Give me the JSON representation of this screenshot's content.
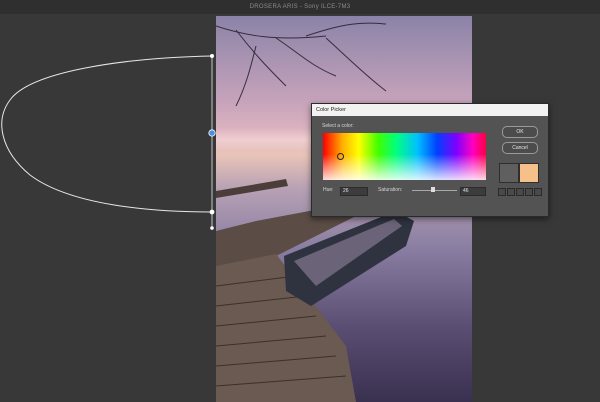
{
  "window": {
    "title": "DROSERA ARIS - Sony ILCE-7M3"
  },
  "color_picker": {
    "title": "Color Picker",
    "prompt": "Select a color:",
    "ok_label": "OK",
    "cancel_label": "Cancel",
    "hue_label": "Hue:",
    "hue_value": "26",
    "saturation_label": "Saturation:",
    "saturation_value": "46",
    "saturation_level": 0.46,
    "selected_color": "#f5c08a",
    "previous_color": "#5f5f5f"
  },
  "colors": {
    "background": "#383838",
    "accent": "#4a8fe0"
  }
}
